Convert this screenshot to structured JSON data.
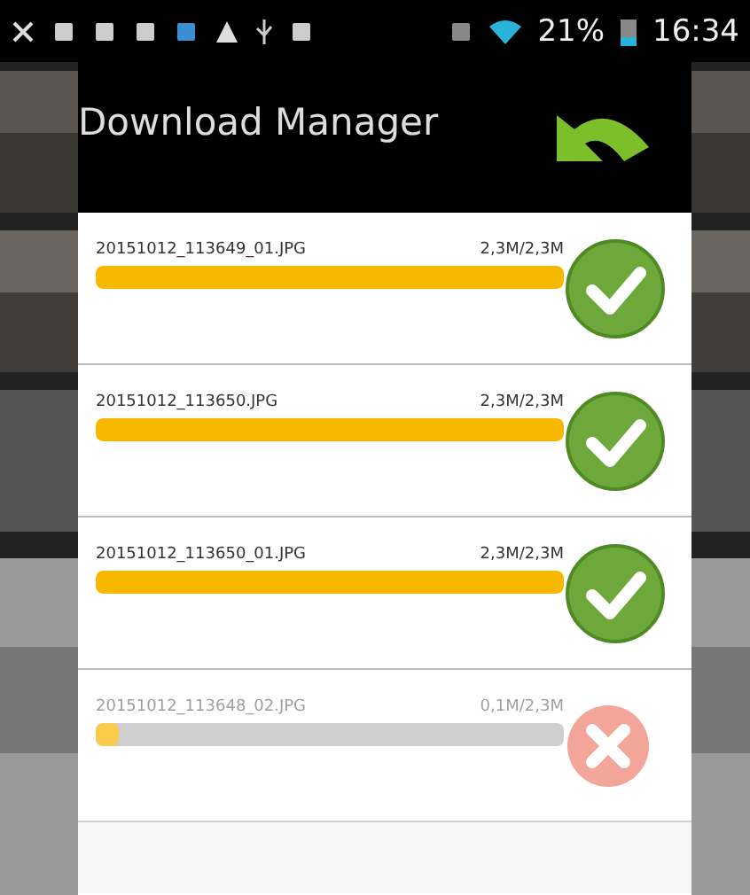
{
  "status_bar": {
    "battery_percent": "21%",
    "time": "16:34"
  },
  "dialog": {
    "title": "Download Manager",
    "downloads": [
      {
        "file": "20151012_113649_01.JPG",
        "size": "2,3M/2,3M",
        "level": 1,
        "kind": "done"
      },
      {
        "file": "20151012_113650.JPG",
        "size": "2,3M/2,3M",
        "level": 1,
        "kind": "done"
      },
      {
        "file": "20151012_113650_01.JPG",
        "size": "2,3M/2,3M",
        "level": 1,
        "kind": "done"
      },
      {
        "file": "20151012_113648_02.JPG",
        "size": "0,1M/2,3M",
        "level": 0.05,
        "kind": "failed"
      }
    ]
  }
}
